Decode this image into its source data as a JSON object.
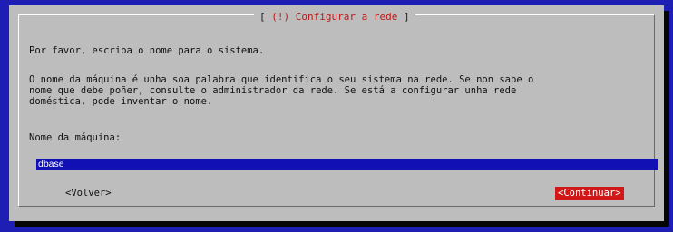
{
  "dialog": {
    "title_brackets_left": "[",
    "title": "(!) Configurar a rede",
    "title_brackets_right": "]",
    "line1": "Por favor, escriba o nome para o sistema.",
    "para_line1": "O nome da máquina é unha soa palabra que identifica o seu sistema na rede. Se non sabe o",
    "para_line2": "nome que debe poñer, consulte o administrador da rede. Se está a configurar unha rede",
    "para_line3": "doméstica, pode inventar o nome.",
    "field_label": "Nome da máquina:",
    "hostname_value": "dbase",
    "back_label": "<Volver>",
    "continue_label": "<Continuar>"
  },
  "colors": {
    "screen_bg": "#1e1eb4",
    "dialog_bg": "#bdbdbd",
    "title_red": "#c01818",
    "input_bg": "#1010b4",
    "button_active_bg": "#d01818"
  }
}
